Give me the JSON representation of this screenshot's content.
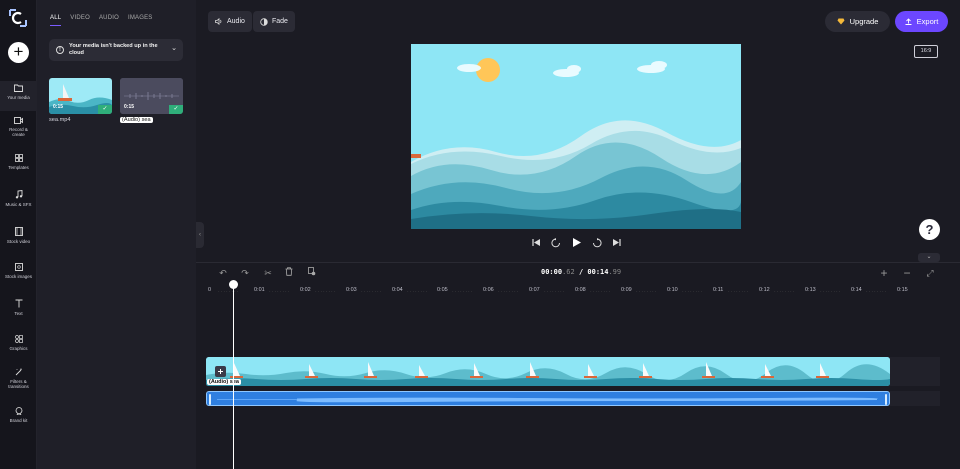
{
  "sidebar": {
    "items": [
      {
        "label": "Your media",
        "icon": "folder-icon"
      },
      {
        "label": "Record & create",
        "icon": "camera-icon"
      },
      {
        "label": "Templates",
        "icon": "grid-icon"
      },
      {
        "label": "Music & SFX",
        "icon": "music-note-icon"
      },
      {
        "label": "Stock video",
        "icon": "film-icon"
      },
      {
        "label": "Stock images",
        "icon": "image-icon"
      },
      {
        "label": "Text",
        "icon": "text-icon"
      },
      {
        "label": "Graphics",
        "icon": "shapes-icon"
      },
      {
        "label": "Filters & transitions",
        "icon": "magic-wand-icon"
      },
      {
        "label": "Brand kit",
        "icon": "badge-icon"
      }
    ]
  },
  "media": {
    "tabs": [
      "ALL",
      "VIDEO",
      "AUDIO",
      "IMAGES"
    ],
    "notice": "Your media isn't backed up in the cloud",
    "items": [
      {
        "name": "sea.mp4",
        "duration": "0:15"
      },
      {
        "name": "(Audio) sea",
        "duration": "0:15"
      }
    ]
  },
  "toolbar": {
    "audio_label": "Audio",
    "fade_label": "Fade",
    "upgrade_label": "Upgrade",
    "export_label": "Export",
    "aspect_ratio": "16:9"
  },
  "timeline": {
    "timecode_current": "00:00",
    "timecode_current_frac": ".62",
    "timecode_separator": "/",
    "timecode_total": "00:14",
    "timecode_total_frac": ".99",
    "ticks": [
      "0",
      "0:01",
      "0:02",
      "0:03",
      "0:04",
      "0:05",
      "0:06",
      "0:07",
      "0:08",
      "0:09",
      "0:10",
      "0:11",
      "0:12",
      "0:13",
      "0:14",
      "0:15"
    ],
    "clip_label": "(Audio) sea"
  },
  "colors": {
    "accent": "#6c47ff",
    "sky": "#8ee6f5",
    "sun": "#ffc658",
    "audio_clip": "#2f7fe0"
  }
}
